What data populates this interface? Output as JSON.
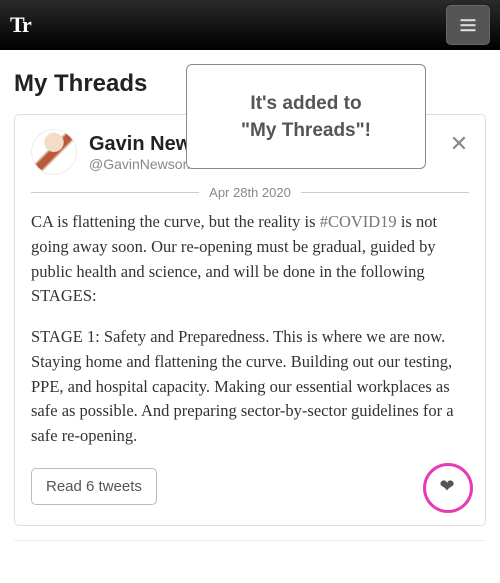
{
  "header": {
    "logo": "Tr"
  },
  "page_title": "My Threads",
  "popup": {
    "line1": "It's added to",
    "line2": "\"My Threads\"!"
  },
  "thread": {
    "author": {
      "display_name": "Gavin News",
      "handle": "@GavinNewsom"
    },
    "date": "Apr 28th 2020",
    "para1_before_tag": "CA is flattening the curve, but the reality is ",
    "para1_hashtag": "#COVID19",
    "para1_after_tag": " is not going away soon. Our re-opening must be gradual, guided by public health and science, and will be done in the following STAGES:",
    "para2": "STAGE 1: Safety and Preparedness. This is where we are now. Staying home and flattening the curve. Building out our testing, PPE, and hospital capacity. Making our essential workplaces as safe as possible. And preparing sector-by-sector guidelines for a safe re-opening.",
    "read_button": "Read 6 tweets"
  }
}
